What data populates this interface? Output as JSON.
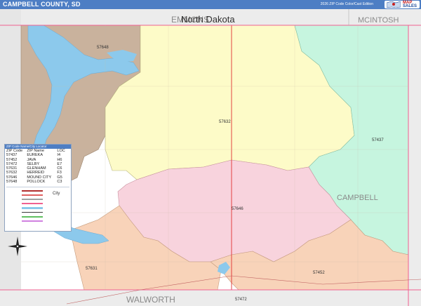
{
  "header": {
    "title": "CAMPBELL COUNTY, SD",
    "edition": "2026 ZIP Code Color/Cast Edition",
    "logo": {
      "line1": "MAP",
      "line2": "SALES"
    }
  },
  "map": {
    "neighbors": {
      "state_north": "North Dakota",
      "county_emmons": "EMMONS",
      "county_mcintosh": "MCINTOSH",
      "county_walworth": "WALWORTH",
      "county_campbell": "CAMPBELL"
    },
    "zip_labels": {
      "z57648": "57648",
      "z57632": "57632",
      "z57437": "57437",
      "z57646": "57646",
      "z57631": "57631",
      "z57452": "57452",
      "z57472": "57472"
    },
    "colors": {
      "z57648": "#c9b29d",
      "z57632": "#fdfbc8",
      "z57437": "#c6f5df",
      "z57646": "#f8d3dd",
      "z57631": "#f8d3b9",
      "z57452": "#f8d3b9",
      "water": "#8cc9ec",
      "ocean_left": "#e6e6e6",
      "county_line": "#f06090",
      "highway": "#e03030"
    }
  },
  "legend": {
    "header": "ZIP Code Name/City Locator",
    "columns": {
      "zip": "ZIP Code",
      "name": "ZIP Name",
      "loc": "LOC"
    },
    "rows": [
      {
        "zip": "57437",
        "name": "EUREKA",
        "loc": "I4"
      },
      {
        "zip": "57452",
        "name": "JAVA",
        "loc": "H6"
      },
      {
        "zip": "57472",
        "name": "SELBY",
        "loc": "E7"
      },
      {
        "zip": "57631",
        "name": "GLENHAM",
        "loc": "C6"
      },
      {
        "zip": "57632",
        "name": "HERREID",
        "loc": "F3"
      },
      {
        "zip": "57646",
        "name": "MOUND CITY",
        "loc": "G5"
      },
      {
        "zip": "57648",
        "name": "POLLOCK",
        "loc": "C3"
      }
    ],
    "city_label": "City"
  }
}
